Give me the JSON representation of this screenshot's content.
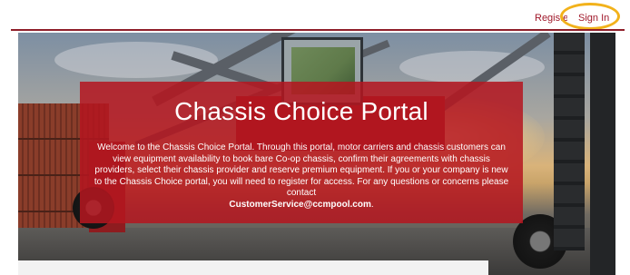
{
  "header": {
    "register_label": "Register",
    "signin_label": "Sign In"
  },
  "hero": {
    "title": "Chassis Choice Portal",
    "description": "Welcome to the Chassis Choice Portal. Through this portal, motor carriers and chassis customers can view equipment availability to book bare Co-op chassis, confirm their agreements with chassis providers, select their chassis provider and reserve premium equipment. If you or your company is new to the Chassis Choice portal, you will need to register for access. For any questions or concerns please contact",
    "contact_email": "CustomerService@ccmpool.com",
    "trailing_punctuation": "."
  },
  "colors": {
    "brand_red": "#b41620",
    "link_red": "#a0182a",
    "highlight": "#f2b21b"
  }
}
